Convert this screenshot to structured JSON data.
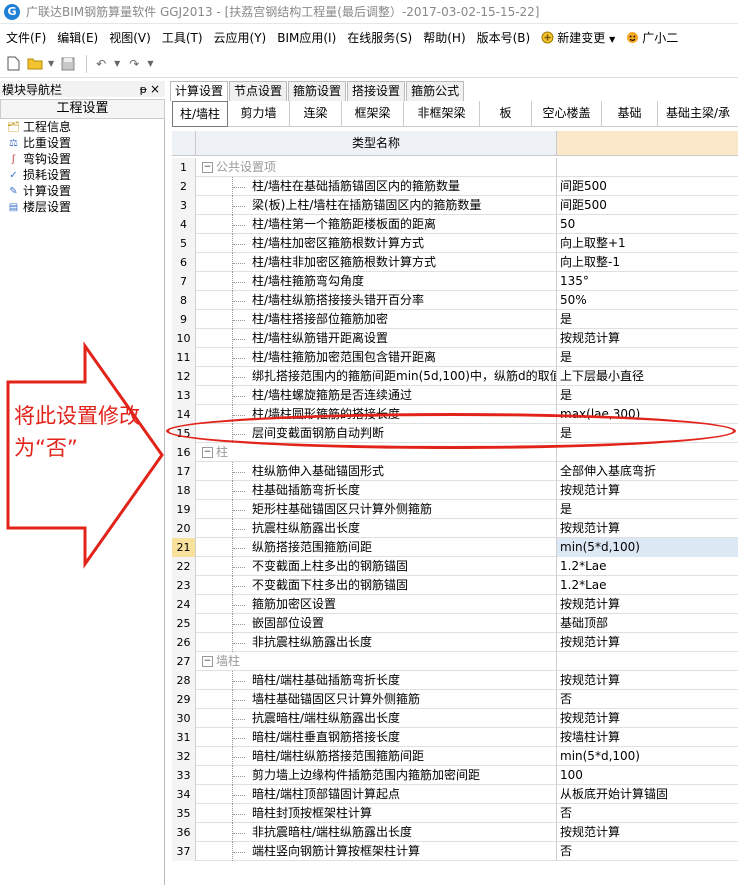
{
  "window": {
    "title": "广联达BIM钢筋算量软件 GGJ2013 - [扶荔宫钢结构工程量(最后调整）-2017-03-02-15-15-22]",
    "app_icon_glyph": "G"
  },
  "menu": [
    "文件(F)",
    "编辑(E)",
    "视图(V)",
    "工具(T)",
    "云应用(Y)",
    "BIM应用(I)",
    "在线服务(S)",
    "帮助(H)",
    "版本号(B)",
    "新建变更",
    "广小二"
  ],
  "navigator": {
    "header": "模块导航栏",
    "pin": "ᵽ",
    "close": "×",
    "tab": "工程设置",
    "items": [
      {
        "label": "工程信息",
        "icon": "info-icon"
      },
      {
        "label": "比重设置",
        "icon": "weight-icon"
      },
      {
        "label": "弯钩设置",
        "icon": "hook-icon"
      },
      {
        "label": "损耗设置",
        "icon": "loss-icon"
      },
      {
        "label": "计算设置",
        "icon": "calc-icon"
      },
      {
        "label": "楼层设置",
        "icon": "floor-icon"
      }
    ]
  },
  "main_tabs": [
    "计算设置",
    "节点设置",
    "箍筋设置",
    "搭接设置",
    "箍筋公式"
  ],
  "sub_tabs": [
    "柱/墙柱",
    "剪力墙",
    "连梁",
    "框架梁",
    "非框架梁",
    "板",
    "空心楼盖",
    "基础",
    "基础主梁/承"
  ],
  "grid": {
    "header_name": "类型名称",
    "rows": [
      {
        "n": "1",
        "group": true,
        "name": "公共设置项",
        "val": ""
      },
      {
        "n": "2",
        "name": "柱/墙柱在基础插筋锚固区内的箍筋数量",
        "val": "间距500"
      },
      {
        "n": "3",
        "name": "梁(板)上柱/墙柱在插筋锚固区内的箍筋数量",
        "val": "间距500"
      },
      {
        "n": "4",
        "name": "柱/墙柱第一个箍筋距楼板面的距离",
        "val": "50"
      },
      {
        "n": "5",
        "name": "柱/墙柱加密区箍筋根数计算方式",
        "val": "向上取整+1"
      },
      {
        "n": "6",
        "name": "柱/墙柱非加密区箍筋根数计算方式",
        "val": "向上取整-1"
      },
      {
        "n": "7",
        "name": "柱/墙柱箍筋弯勾角度",
        "val": "135°"
      },
      {
        "n": "8",
        "name": "柱/墙柱纵筋搭接接头错开百分率",
        "val": "50%"
      },
      {
        "n": "9",
        "name": "柱/墙柱搭接部位箍筋加密",
        "val": "是"
      },
      {
        "n": "10",
        "name": "柱/墙柱纵筋错开距离设置",
        "val": "按规范计算"
      },
      {
        "n": "11",
        "name": "柱/墙柱箍筋加密范围包含错开距离",
        "val": "是"
      },
      {
        "n": "12",
        "name": "绑扎搭接范围内的箍筋间距min(5d,100)中，纵筋d的取值",
        "val": "上下层最小直径"
      },
      {
        "n": "13",
        "name": "柱/墙柱螺旋箍筋是否连续通过",
        "val": "是"
      },
      {
        "n": "14",
        "name": "柱/墙柱圆形箍筋的搭接长度",
        "val": "max(lae,300)"
      },
      {
        "n": "15",
        "name": "层间变截面钢筋自动判断",
        "val": "是"
      },
      {
        "n": "16",
        "group": true,
        "name": "柱",
        "val": ""
      },
      {
        "n": "17",
        "name": "柱纵筋伸入基础锚固形式",
        "val": "全部伸入基底弯折"
      },
      {
        "n": "18",
        "name": "柱基础插筋弯折长度",
        "val": "按规范计算"
      },
      {
        "n": "19",
        "name": "矩形柱基础锚固区只计算外侧箍筋",
        "val": "是"
      },
      {
        "n": "20",
        "name": "抗震柱纵筋露出长度",
        "val": "按规范计算"
      },
      {
        "n": "21",
        "name": "纵筋搭接范围箍筋间距",
        "val": "min(5*d,100)",
        "selected": true
      },
      {
        "n": "22",
        "name": "不变截面上柱多出的钢筋锚固",
        "val": "1.2*Lae"
      },
      {
        "n": "23",
        "name": "不变截面下柱多出的钢筋锚固",
        "val": "1.2*Lae"
      },
      {
        "n": "24",
        "name": "箍筋加密区设置",
        "val": "按规范计算"
      },
      {
        "n": "25",
        "name": "嵌固部位设置",
        "val": "基础顶部"
      },
      {
        "n": "26",
        "name": "非抗震柱纵筋露出长度",
        "val": "按规范计算"
      },
      {
        "n": "27",
        "group": true,
        "name": "墙柱",
        "val": ""
      },
      {
        "n": "28",
        "name": "暗柱/端柱基础插筋弯折长度",
        "val": "按规范计算"
      },
      {
        "n": "29",
        "name": "墙柱基础锚固区只计算外侧箍筋",
        "val": "否"
      },
      {
        "n": "30",
        "name": "抗震暗柱/端柱纵筋露出长度",
        "val": "按规范计算"
      },
      {
        "n": "31",
        "name": "暗柱/端柱垂直钢筋搭接长度",
        "val": "按墙柱计算"
      },
      {
        "n": "32",
        "name": "暗柱/端柱纵筋搭接范围箍筋间距",
        "val": "min(5*d,100)"
      },
      {
        "n": "33",
        "name": "剪力墙上边缘构件插筋范围内箍筋加密间距",
        "val": "100"
      },
      {
        "n": "34",
        "name": "暗柱/端柱顶部锚固计算起点",
        "val": "从板底开始计算锚固"
      },
      {
        "n": "35",
        "name": "暗柱封顶按框架柱计算",
        "val": "否"
      },
      {
        "n": "36",
        "name": "非抗震暗柱/端柱纵筋露出长度",
        "val": "按规范计算"
      },
      {
        "n": "37",
        "name": "端柱竖向钢筋计算按框架柱计算",
        "val": "否"
      }
    ]
  },
  "annotation": {
    "text": "将此设置修改为“否”",
    "color": "#e2231a"
  }
}
